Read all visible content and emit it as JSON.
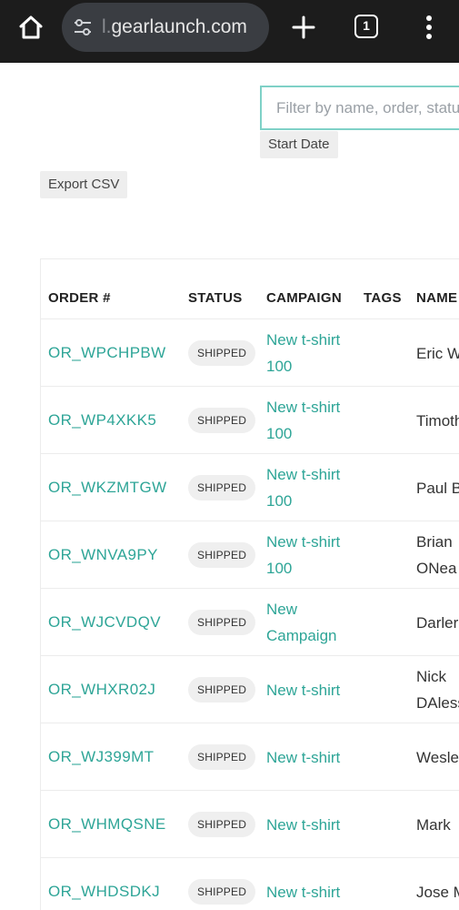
{
  "browser": {
    "url_prefix": "l.",
    "url_domain": "gearlaunch.com",
    "tab_count": "1",
    "icons": [
      "home-icon",
      "site-settings-icon",
      "new-tab-icon",
      "tabs-icon",
      "more-vert-icon"
    ]
  },
  "filter": {
    "placeholder": "Filter by name, order, status"
  },
  "buttons": {
    "start_date": "Start Date",
    "export_csv": "Export CSV"
  },
  "table": {
    "headers": {
      "order": "ORDER #",
      "status": "STATUS",
      "campaign": "CAMPAIGN",
      "tags": "TAGS",
      "name": "NAME"
    },
    "rows": [
      {
        "order": "OR_WPCHPBW",
        "status": "SHIPPED",
        "campaign": "New t-shirt 100",
        "name": "Eric W"
      },
      {
        "order": "OR_WP4XKK5",
        "status": "SHIPPED",
        "campaign": "New t-shirt 100",
        "name": "Timoth"
      },
      {
        "order": "OR_WKZMTGW",
        "status": "SHIPPED",
        "campaign": "New t-shirt 100",
        "name": "Paul B"
      },
      {
        "order": "OR_WNVA9PY",
        "status": "SHIPPED",
        "campaign": "New t-shirt 100",
        "name": "Brian ONea"
      },
      {
        "order": "OR_WJCVDQV",
        "status": "SHIPPED",
        "campaign": "New Campaign",
        "name": "Darler"
      },
      {
        "order": "OR_WHXR02J",
        "status": "SHIPPED",
        "campaign": "New t-shirt",
        "name": "Nick DAless"
      },
      {
        "order": "OR_WJ399MT",
        "status": "SHIPPED",
        "campaign": "New t-shirt",
        "name": "Wesle"
      },
      {
        "order": "OR_WHMQSNE",
        "status": "SHIPPED",
        "campaign": "New t-shirt",
        "name": "Mark"
      },
      {
        "order": "OR_WHDSDKJ",
        "status": "SHIPPED",
        "campaign": "New t-shirt",
        "name": "Jose M"
      }
    ]
  },
  "colors": {
    "accent": "#2ea597",
    "filter_border": "#7fd1c7",
    "chrome_bg": "#1c1c1c",
    "urlbar_bg": "#3a3d42"
  }
}
